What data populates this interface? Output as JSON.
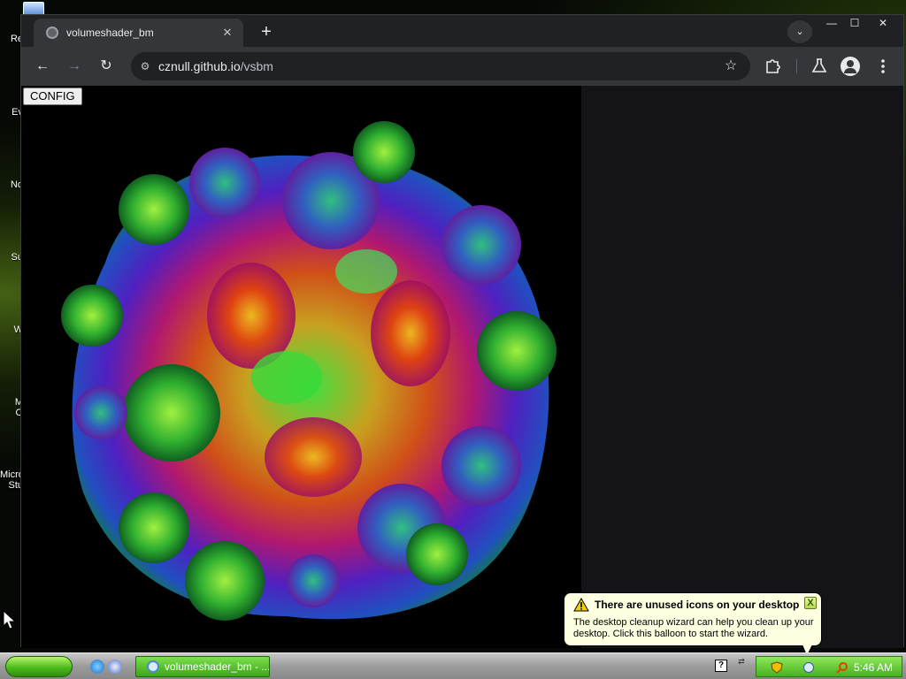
{
  "desktop": {
    "icon_labels": [
      "Re",
      "Ev",
      "No",
      "Su",
      "W",
      "M",
      "O",
      "Micro",
      "Stu"
    ]
  },
  "browser": {
    "tab": {
      "title": "volumeshader_bm",
      "close_icon": "close-icon",
      "favicon": "globe-icon"
    },
    "new_tab_label": "+",
    "window_controls": {
      "minimize": "—",
      "maximize": "☐",
      "close": "✕"
    },
    "toolbar": {
      "back": "←",
      "forward": "→",
      "reload": "↻",
      "url_host": "cznull.github.io",
      "url_path": "/vsbm",
      "bookmark_icon": "star-icon",
      "extensions_icon": "puzzle-icon",
      "labs_icon": "flask-icon",
      "profile_icon": "avatar-icon",
      "menu_icon": "kebab-icon"
    }
  },
  "page": {
    "config_button": "CONFIG"
  },
  "taskbar": {
    "task_label": "volumeshader_bm - ...",
    "help_label": "?",
    "clock": "5:46 AM"
  },
  "balloon": {
    "title": "There are unused icons on your desktop",
    "body": "The desktop cleanup wizard can help you clean up your desktop. Click this balloon to start the wizard.",
    "close_label": "X"
  },
  "colors": {
    "chrome_dark": "#202124",
    "chrome_toolbar": "#35363a",
    "xp_green": "#46b020",
    "balloon_bg": "#ffffe1"
  }
}
